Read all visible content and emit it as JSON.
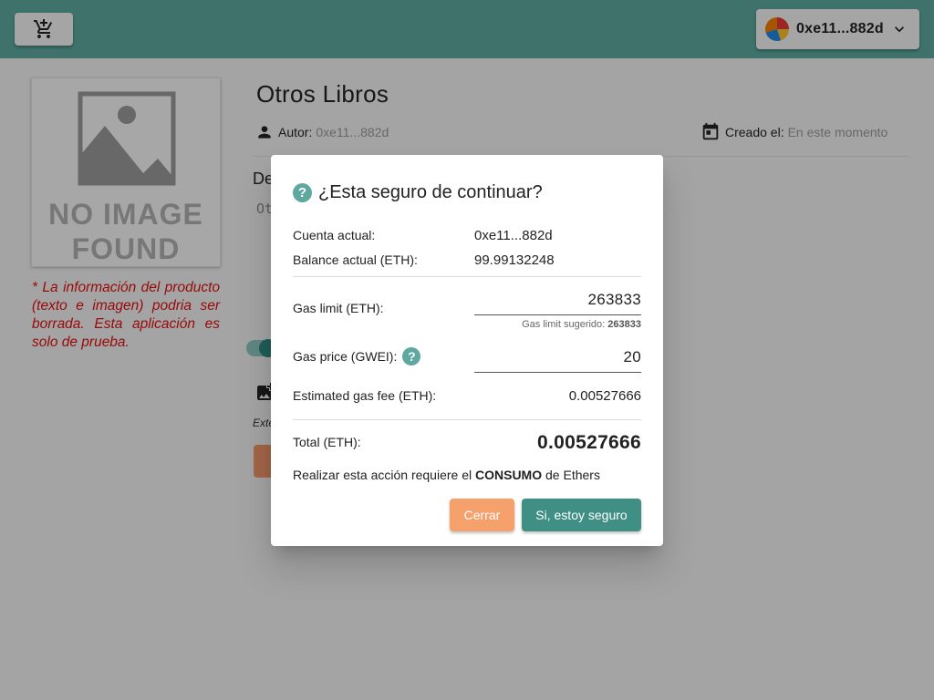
{
  "topbar": {
    "cart_icon": "add-shopping-cart-icon",
    "account_label": "0xe11...882d",
    "account_avatar": "identicon-avatar",
    "account_chevron": "chevron-down-icon",
    "bar_color": "#5fa8a0"
  },
  "book": {
    "placeholder_text": "NO IMAGE FOUND",
    "placeholder_line1": "NO IMAGE",
    "placeholder_line2": "FOUND",
    "warning": "* La información del producto (texto e imagen) podria ser borrada. Esta aplicación es solo de prueba.",
    "title": "Otros Libros",
    "author_label": "Autor:",
    "author_value": "0xe11...882d",
    "created_label": "Creado el:",
    "created_value": "En este momento",
    "description_label": "De",
    "description_value": "Ot",
    "extra_text": "Exte"
  },
  "dialog": {
    "title": "¿Esta seguro de continuar?",
    "help_glyph": "?",
    "current_account_label": "Cuenta actual:",
    "current_account_value": "0xe11...882d",
    "balance_label": "Balance actual (ETH):",
    "balance_value": "99.99132248",
    "gas_limit_label": "Gas limit (ETH):",
    "gas_limit_value": "263833",
    "gas_limit_hint_label": "Gas limit sugerido:",
    "gas_limit_hint_value": "263833",
    "gas_price_label": "Gas price (GWEI):",
    "gas_price_value": "20",
    "fee_label": "Estimated gas fee (ETH):",
    "fee_value": "0.00527666",
    "total_label": "Total (ETH):",
    "total_value": "0.00527666",
    "note_before": "Realizar esta acción requiere el ",
    "note_bold": "CONSUMO",
    "note_after": " de Ethers",
    "cancel_label": "Cerrar",
    "confirm_label": "Si, estoy seguro",
    "accent_color": "#3f8f84",
    "cancel_color": "#f6a06c"
  }
}
